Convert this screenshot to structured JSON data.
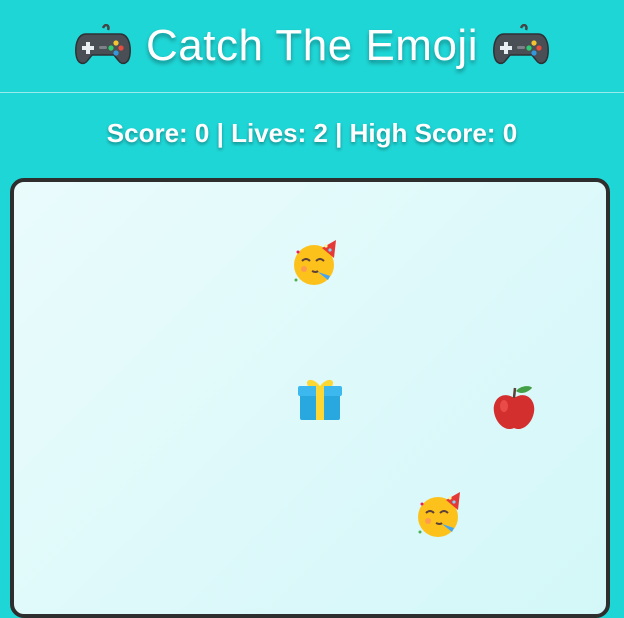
{
  "header": {
    "title": "Catch The Emoji",
    "left_icon": "gamepad-icon",
    "right_icon": "gamepad-icon"
  },
  "scoreline": {
    "text": "Score: 0 | Lives: 2 | High Score: 0",
    "score": 0,
    "lives": 2,
    "high_score": 0
  },
  "game_area": {
    "falling_items": [
      {
        "icon": "party-face-emoji"
      },
      {
        "icon": "gift-emoji"
      },
      {
        "icon": "red-apple-emoji"
      },
      {
        "icon": "party-face-emoji"
      }
    ]
  },
  "colors": {
    "background": "#1fd6d6",
    "game_area": "#ddf8f9",
    "border": "#2e2e2e"
  }
}
